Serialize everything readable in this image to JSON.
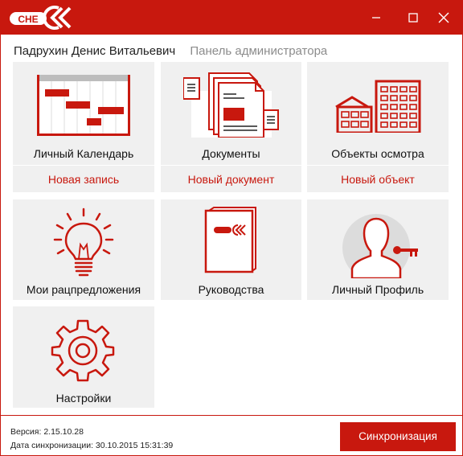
{
  "window": {
    "logo_text": "СНЕ",
    "minimize_icon": "minimize-icon",
    "maximize_icon": "maximize-icon",
    "close_icon": "close-icon",
    "accent_color": "#c8180e"
  },
  "header": {
    "user_name": "Падрухин Денис Витальевич",
    "admin_panel": "Панель администратора"
  },
  "tiles": [
    {
      "label": "Личный Календарь",
      "link": "Новая запись",
      "icon": "calendar-icon"
    },
    {
      "label": "Документы",
      "link": "Новый документ",
      "icon": "documents-icon"
    },
    {
      "label": "Объекты осмотра",
      "link": "Новый объект",
      "icon": "buildings-icon"
    },
    {
      "label": "Мои рацпредложения",
      "icon": "lightbulb-icon"
    },
    {
      "label": "Руководства",
      "icon": "manual-icon"
    },
    {
      "label": "Личный Профиль",
      "icon": "profile-icon"
    },
    {
      "label": "Настройки",
      "icon": "gear-icon"
    }
  ],
  "footer": {
    "version": "Версия: 2.15.10.28",
    "sync_date": "Дата синхронизации: 30.10.2015 15:31:39",
    "sync_button": "Синхронизация"
  }
}
